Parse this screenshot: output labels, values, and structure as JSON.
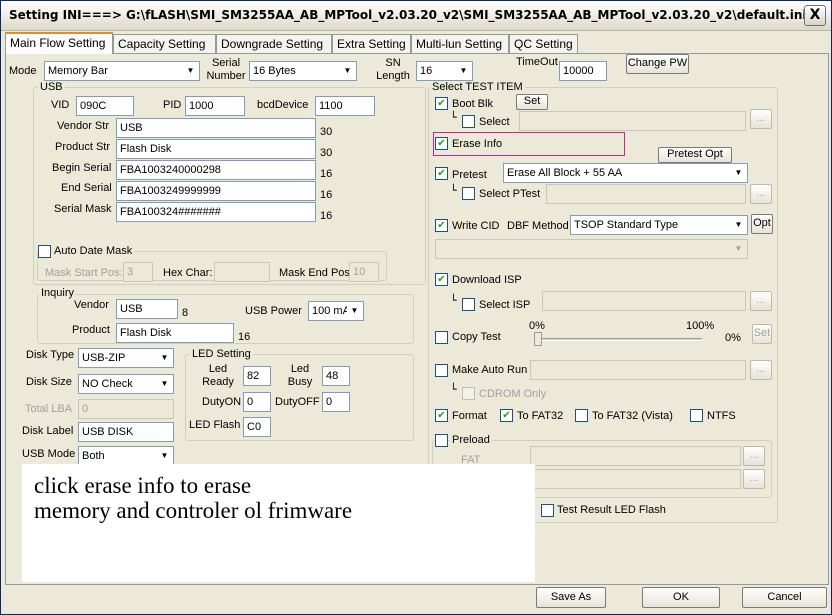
{
  "window": {
    "title": "Setting  INI===> G:\\fLASH\\SMI_SM3255AA_AB_MPTool_v2.03.20_v2\\SMI_SM3255AA_AB_MPTool_v2.03.20_v2\\default.ini",
    "close_label": "X"
  },
  "tabs": [
    "Main Flow Setting",
    "Capacity Setting",
    "Downgrade Setting",
    "Extra Setting",
    "Multi-lun Setting",
    "QC Setting"
  ],
  "top": {
    "mode_label": "Mode",
    "mode_value": "Memory Bar",
    "serial_number_label": "Serial Number",
    "serial_number_value": "16 Bytes",
    "sn_length_label": "SN Length",
    "sn_length_value": "16",
    "timeout_label": "TimeOut",
    "timeout_value": "10000",
    "change_pw_label": "Change PW"
  },
  "usb": {
    "title": "USB",
    "vid_label": "VID",
    "vid_value": "090C",
    "pid_label": "PID",
    "pid_value": "1000",
    "bcd_label": "bcdDevice",
    "bcd_value": "1100",
    "vendor_str_label": "Vendor Str",
    "vendor_str_value": "USB",
    "vendor_str_len": "30",
    "product_str_label": "Product Str",
    "product_str_value": "Flash Disk",
    "product_str_len": "30",
    "begin_serial_label": "Begin Serial",
    "begin_serial_value": "FBA1003240000298",
    "begin_serial_len": "16",
    "end_serial_label": "End Serial",
    "end_serial_value": "FBA1003249999999",
    "end_serial_len": "16",
    "serial_mask_label": "Serial Mask",
    "serial_mask_value": "FBA100324#######",
    "serial_mask_len": "16",
    "auto_date_mask_label": "Auto Date Mask",
    "mask_start_label": "Mask Start Pos:",
    "mask_start_value": "3",
    "hex_char_label": "Hex Char:",
    "hex_char_value": "",
    "mask_end_label": "Mask End Pos:",
    "mask_end_value": "10"
  },
  "inquiry": {
    "title": "Inquiry",
    "vendor_label": "Vendor",
    "vendor_value": "USB",
    "vendor_len": "8",
    "product_label": "Product",
    "product_value": "Flash Disk",
    "product_len": "16",
    "usb_power_label": "USB Power",
    "usb_power_value": "100 mA"
  },
  "disk": {
    "disk_type_label": "Disk Type",
    "disk_type_value": "USB-ZIP",
    "disk_size_label": "Disk Size",
    "disk_size_value": "NO Check",
    "total_lba_label": "Total LBA",
    "total_lba_value": "0",
    "disk_label_label": "Disk Label",
    "disk_label_value": "USB DISK",
    "usb_mode_label": "USB Mode",
    "usb_mode_value": "Both"
  },
  "led": {
    "title": "LED Setting",
    "led_ready_label": "Led Ready",
    "led_ready_value": "82",
    "led_busy_label": "Led Busy",
    "led_busy_value": "48",
    "duty_on_label": "DutyON",
    "duty_on_value": "0",
    "duty_off_label": "DutyOFF",
    "duty_off_value": "0",
    "led_flash_label": "LED Flash",
    "led_flash_value": "C0"
  },
  "test": {
    "title": "Select TEST ITEM",
    "boot_blk_label": "Boot Blk",
    "set_label": "Set",
    "select_label": "Select",
    "erase_info_label": "Erase Info",
    "pretest_opt_label": "Pretest Opt",
    "pretest_label": "Pretest",
    "pretest_value": "Erase All Block + 55 AA",
    "select_ptest_label": "Select PTest",
    "write_cid_label": "Write CID",
    "dbf_method_label": "DBF Method",
    "dbf_method_value": "TSOP Standard Type",
    "opt_label": "Opt",
    "download_isp_label": "Download ISP",
    "select_isp_label": "Select ISP",
    "copy_test_label": "Copy Test",
    "pct_min": "0%",
    "pct_max": "100%",
    "pct_value": "0%",
    "make_auto_run_label": "Make Auto Run",
    "cdrom_only_label": "CDROM Only",
    "format_label": "Format",
    "fat32_label": "To FAT32",
    "fat32_vista_label": "To FAT32 (Vista)",
    "ntfs_label": "NTFS",
    "preload_label": "Preload",
    "fat_label": "FAT",
    "test_result_led_label": "Test Result LED Flash",
    "ellipsis": "...",
    "checked_mark": "✔"
  },
  "note": {
    "line1": "click erase info to erase",
    "line2": "memory and controler ol frimware"
  },
  "footer": {
    "save_as_label": "Save  As",
    "ok_label": "OK",
    "cancel_label": "Cancel"
  }
}
